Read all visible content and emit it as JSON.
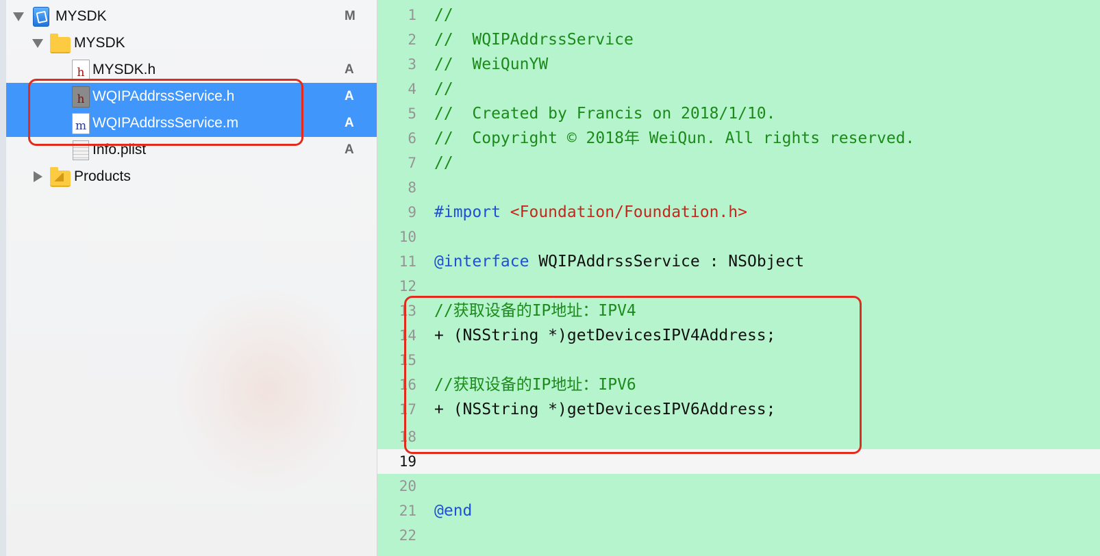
{
  "navigator": {
    "items": [
      {
        "label": "MYSDK",
        "badge": "M",
        "icon": "xcode-project-icon"
      },
      {
        "label": "MYSDK",
        "badge": "",
        "icon": "folder-icon"
      },
      {
        "label": "MYSDK.h",
        "badge": "A",
        "icon": "header-file-icon"
      },
      {
        "label": "WQIPAddrssService.h",
        "badge": "A",
        "icon": "header-file-icon"
      },
      {
        "label": "WQIPAddrssService.m",
        "badge": "A",
        "icon": "implementation-file-icon"
      },
      {
        "label": "Info.plist",
        "badge": "A",
        "icon": "plist-file-icon"
      },
      {
        "label": "Products",
        "badge": "",
        "icon": "folder-icon"
      }
    ]
  },
  "editor": {
    "current_line": 19,
    "lines": [
      {
        "n": "1",
        "tokens": [
          {
            "t": "//",
            "k": "comment"
          }
        ]
      },
      {
        "n": "2",
        "tokens": [
          {
            "t": "//  WQIPAddrssService",
            "k": "comment"
          }
        ]
      },
      {
        "n": "3",
        "tokens": [
          {
            "t": "//  WeiQunYW",
            "k": "comment"
          }
        ]
      },
      {
        "n": "4",
        "tokens": [
          {
            "t": "//",
            "k": "comment"
          }
        ]
      },
      {
        "n": "5",
        "tokens": [
          {
            "t": "//  Created by Francis on 2018/1/10.",
            "k": "comment"
          }
        ]
      },
      {
        "n": "6",
        "tokens": [
          {
            "t": "//  Copyright © 2018年 WeiQun. All rights reserved.",
            "k": "comment"
          }
        ]
      },
      {
        "n": "7",
        "tokens": [
          {
            "t": "//",
            "k": "comment"
          }
        ]
      },
      {
        "n": "8",
        "tokens": []
      },
      {
        "n": "9",
        "tokens": [
          {
            "t": "#import",
            "k": "keyword"
          },
          {
            "t": " ",
            "k": "plain"
          },
          {
            "t": "<Foundation/Foundation.h>",
            "k": "string"
          }
        ]
      },
      {
        "n": "10",
        "tokens": []
      },
      {
        "n": "11",
        "tokens": [
          {
            "t": "@interface",
            "k": "keyword"
          },
          {
            "t": " WQIPAddrssService : NSObject",
            "k": "plain"
          }
        ]
      },
      {
        "n": "12",
        "tokens": []
      },
      {
        "n": "13",
        "tokens": [
          {
            "t": "//获取设备的IP地址：IPV4",
            "k": "comment"
          }
        ]
      },
      {
        "n": "14",
        "tokens": [
          {
            "t": "+ (NSString *)getDevicesIPV4Address;",
            "k": "plain"
          }
        ]
      },
      {
        "n": "15",
        "tokens": []
      },
      {
        "n": "16",
        "tokens": [
          {
            "t": "//获取设备的IP地址：IPV6",
            "k": "comment"
          }
        ]
      },
      {
        "n": "17",
        "tokens": [
          {
            "t": "+ (NSString *)getDevicesIPV6Address;",
            "k": "plain"
          }
        ]
      },
      {
        "n": "18",
        "tokens": []
      },
      {
        "n": "19",
        "tokens": []
      },
      {
        "n": "20",
        "tokens": []
      },
      {
        "n": "21",
        "tokens": [
          {
            "t": "@end",
            "k": "keyword"
          }
        ]
      },
      {
        "n": "22",
        "tokens": []
      }
    ]
  },
  "colors": {
    "editor_background": "#b6f4cd",
    "selection": "#4096fb",
    "comment": "#1b8a1b",
    "keyword": "#1f4fd6",
    "string": "#c4281d",
    "annotation": "#e22b1c"
  }
}
